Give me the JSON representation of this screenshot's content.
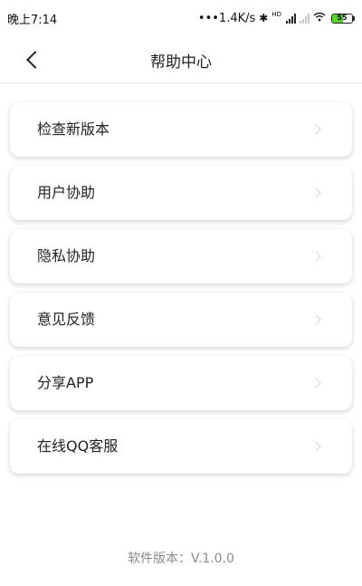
{
  "status_bar": {
    "time": "晚上7:14",
    "network_speed": "•••1.4K/s",
    "bluetooth_icon": "bluetooth-icon",
    "hd_label": "HD",
    "battery_level": "55",
    "battery_fraction": 0.55,
    "battery_color": "#5bd12d"
  },
  "header": {
    "title": "帮助中心",
    "back_icon": "chevron-left-icon"
  },
  "menu": {
    "items": [
      {
        "label": "检查新版本",
        "icon": "chevron-right-icon"
      },
      {
        "label": "用户协助",
        "icon": "chevron-right-icon"
      },
      {
        "label": "隐私协助",
        "icon": "chevron-right-icon"
      },
      {
        "label": "意见反馈",
        "icon": "chevron-right-icon"
      },
      {
        "label": "分享APP",
        "icon": "chevron-right-icon"
      },
      {
        "label": "在线QQ客服",
        "icon": "chevron-right-icon"
      }
    ]
  },
  "footer": {
    "version": "软件版本：V.1.0.0"
  }
}
